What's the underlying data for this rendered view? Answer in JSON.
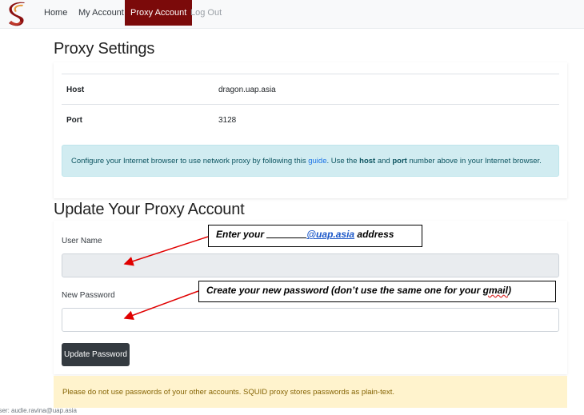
{
  "nav": {
    "items": [
      {
        "label": "Home"
      },
      {
        "label": "My Account"
      },
      {
        "label": "Proxy Account"
      },
      {
        "label": "Log Out"
      }
    ]
  },
  "proxy_settings": {
    "title": "Proxy Settings",
    "rows": [
      {
        "key": "Host",
        "value": "dragon.uap.asia"
      },
      {
        "key": "Port",
        "value": "3128"
      }
    ],
    "info": {
      "prefix": "Configure your Internet browser to use network proxy by following this ",
      "link": "guide",
      "mid1": ". Use the ",
      "host_word": "host",
      "mid2": " and ",
      "port_word": "port",
      "suffix": " number above in your Internet browser."
    }
  },
  "update_account": {
    "title": "Update Your Proxy Account",
    "username_label": "User Name",
    "username_value": "",
    "password_label": "New Password",
    "password_value": "",
    "submit_label": "Update Password"
  },
  "warning": "Please do not use passwords of your other accounts. SQUID proxy stores passwords as plain-text.",
  "footer": "user: audie.ravina@uap.asia",
  "annotations": {
    "callout1": {
      "prefix": "Enter your ",
      "domain": "@uap.asia",
      "suffix": " address"
    },
    "callout2": {
      "prefix": "Create your new password (don’t use the same one for your ",
      "gmail": "gmail",
      "suffix": ")"
    }
  },
  "colors": {
    "brand": "#7b0a0a",
    "info_bg": "#d1ecf1",
    "warn_bg": "#fff3cd",
    "arrow": "#e00000"
  }
}
